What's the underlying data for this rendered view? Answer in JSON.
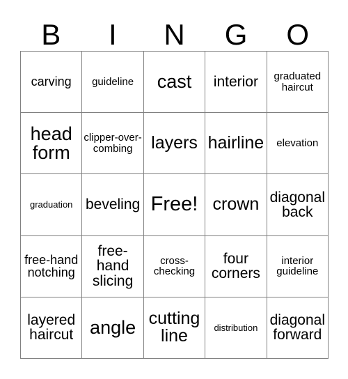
{
  "card": {
    "title": "BINGO",
    "header_letters": [
      "B",
      "I",
      "N",
      "G",
      "O"
    ],
    "grid_size": "5x5",
    "free_space": "Free!",
    "border_color": "#808080",
    "text_color": "#000000",
    "background_color": "#ffffff",
    "rows": [
      [
        {
          "text": "carving",
          "size": "md"
        },
        {
          "text": "guideline",
          "size": "sm"
        },
        {
          "text": "cast",
          "size": "xxl"
        },
        {
          "text": "interior",
          "size": "lg"
        },
        {
          "text": "graduated haircut",
          "size": "sm"
        }
      ],
      [
        {
          "text": "head form",
          "size": "xxl"
        },
        {
          "text": "clipper-over-combing",
          "size": "sm"
        },
        {
          "text": "layers",
          "size": "xl"
        },
        {
          "text": "hairline",
          "size": "xl"
        },
        {
          "text": "elevation",
          "size": "sm"
        }
      ],
      [
        {
          "text": "graduation",
          "size": "xs"
        },
        {
          "text": "beveling",
          "size": "lg"
        },
        {
          "text": "Free!",
          "size": "free"
        },
        {
          "text": "crown",
          "size": "xl"
        },
        {
          "text": "diagonal back",
          "size": "lg"
        }
      ],
      [
        {
          "text": "free-hand notching",
          "size": "md"
        },
        {
          "text": "free-hand slicing",
          "size": "lg"
        },
        {
          "text": "cross-checking",
          "size": "sm"
        },
        {
          "text": "four corners",
          "size": "lg"
        },
        {
          "text": "interior guideline",
          "size": "sm"
        }
      ],
      [
        {
          "text": "layered haircut",
          "size": "lg"
        },
        {
          "text": "angle",
          "size": "xxl"
        },
        {
          "text": "cutting line",
          "size": "xl"
        },
        {
          "text": "distribution",
          "size": "xs"
        },
        {
          "text": "diagonal forward",
          "size": "lg"
        }
      ]
    ]
  }
}
